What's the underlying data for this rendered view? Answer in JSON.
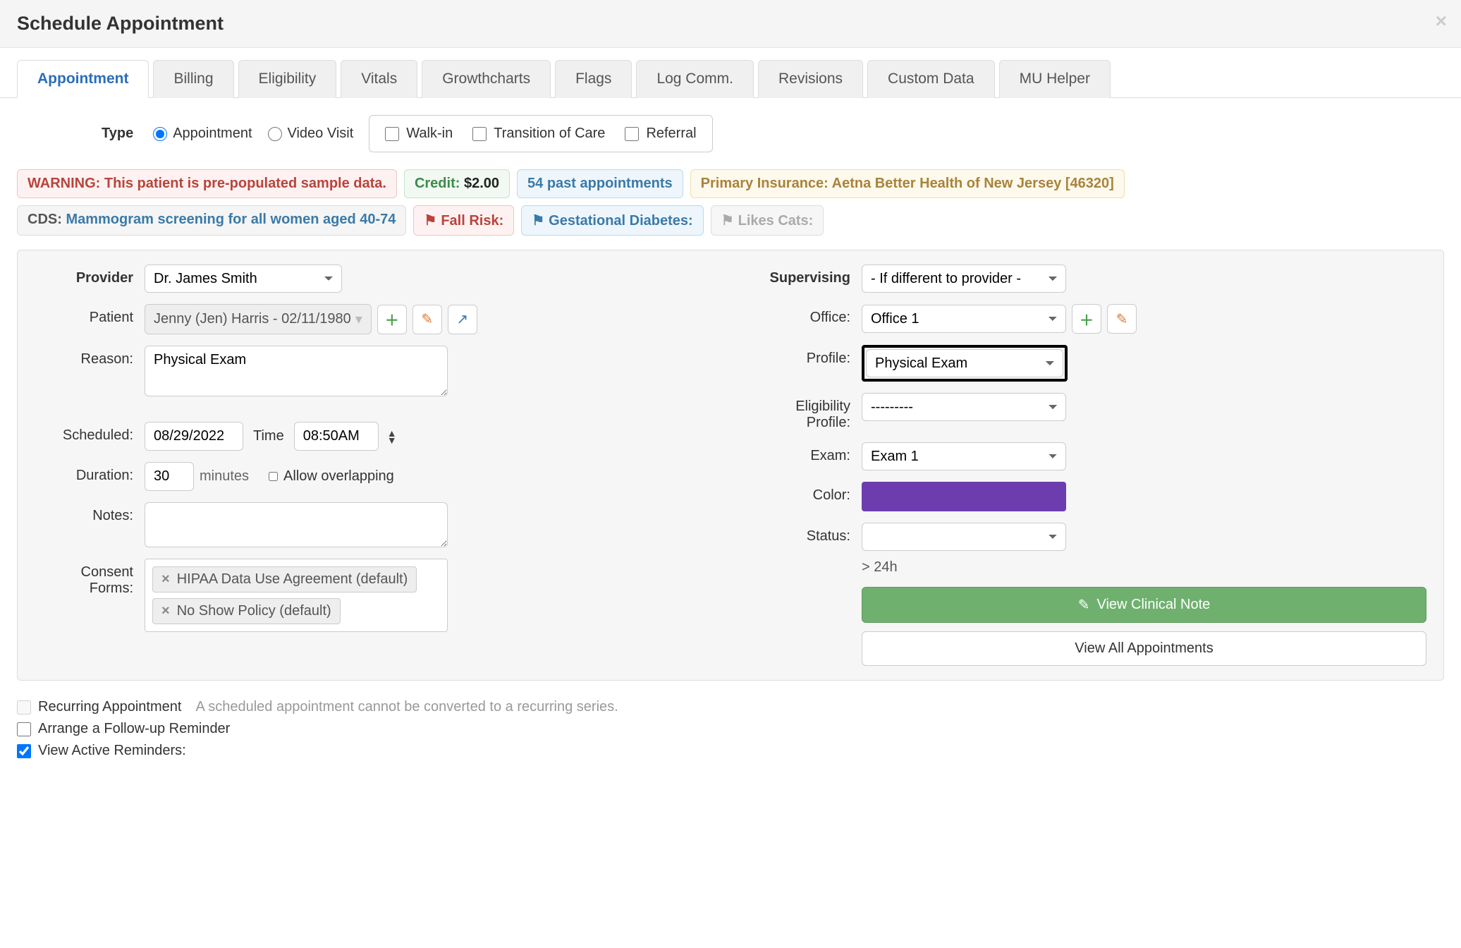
{
  "header": {
    "title": "Schedule Appointment"
  },
  "tabs": [
    {
      "label": "Appointment",
      "active": true
    },
    {
      "label": "Billing"
    },
    {
      "label": "Eligibility"
    },
    {
      "label": "Vitals"
    },
    {
      "label": "Growthcharts"
    },
    {
      "label": "Flags"
    },
    {
      "label": "Log Comm."
    },
    {
      "label": "Revisions"
    },
    {
      "label": "Custom Data"
    },
    {
      "label": "MU Helper"
    }
  ],
  "type": {
    "label": "Type",
    "options": {
      "appointment": "Appointment",
      "video": "Video Visit"
    },
    "checks": {
      "walkin": "Walk-in",
      "transition": "Transition of Care",
      "referral": "Referral"
    }
  },
  "badges": {
    "warning": "WARNING: This patient is pre-populated sample data.",
    "credit_label": "Credit:",
    "credit_value": "$2.00",
    "past": "54 past appointments",
    "insurance": "Primary Insurance: Aetna Better Health of New Jersey [46320]",
    "cds_label": "CDS:",
    "cds_link": "Mammogram screening for all women aged 40-74",
    "fall_risk": "Fall Risk:",
    "gest_diabetes": "Gestational Diabetes:",
    "likes_cats": "Likes Cats:"
  },
  "labels": {
    "provider": "Provider",
    "patient": "Patient",
    "reason": "Reason:",
    "scheduled": "Scheduled:",
    "time": "Time",
    "duration": "Duration:",
    "minutes": "minutes",
    "allow_overlap": "Allow overlapping",
    "notes": "Notes:",
    "consent": "Consent Forms:",
    "supervising": "Supervising",
    "office": "Office:",
    "profile": "Profile:",
    "elig_profile": "Eligibility Profile:",
    "exam": "Exam:",
    "color": "Color:",
    "status": "Status:",
    "gt24": "> 24h"
  },
  "values": {
    "provider": "Dr. James Smith",
    "patient": "Jenny (Jen) Harris - 02/11/1980",
    "reason": "Physical Exam",
    "date": "08/29/2022",
    "time": "08:50AM",
    "duration": "30",
    "supervising": "- If different to provider -",
    "office": "Office 1",
    "profile": "Physical Exam",
    "elig_profile": "---------",
    "exam": "Exam 1",
    "status": "",
    "color": "#6d3db0"
  },
  "consent_forms": [
    "HIPAA Data Use Agreement (default)",
    "No Show Policy (default)"
  ],
  "buttons": {
    "view_clinical": "View Clinical Note",
    "view_all": "View All Appointments"
  },
  "bottom": {
    "recurring": "Recurring Appointment",
    "recurring_hint": "A scheduled appointment cannot be converted to a recurring series.",
    "followup": "Arrange a Follow-up Reminder",
    "active_reminders": "View Active Reminders:"
  }
}
